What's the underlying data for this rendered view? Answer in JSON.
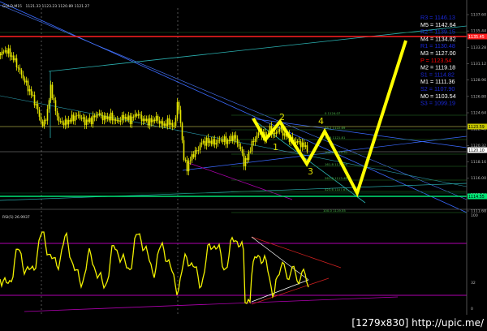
{
  "chart_header": {
    "symbol_info": "GOLD,M15",
    "prices": "1121.33 1123.23 1120.89 1121.27",
    "rsi_label": "RSI(5) 26.9937"
  },
  "colors": {
    "background": "#000000",
    "candles": "#e8e800",
    "rsi_line": "#f2f200",
    "forecast": "#ffff00",
    "red_line": "#ff2020",
    "green_line": "#00e676",
    "teal": "#2ab0b0",
    "blue_line": "#3a6aff",
    "magenta": "#b000b0",
    "level_dark_blue": "#1a28d8",
    "level_red": "#ff0000",
    "level_white": "#ffffff"
  },
  "pivot_levels": [
    {
      "name": "R3",
      "value": "1146.13",
      "style": "dark-blue"
    },
    {
      "name": "M5",
      "value": "1142.64",
      "style": "white"
    },
    {
      "name": "R2",
      "value": "1139.15",
      "style": "dark-blue"
    },
    {
      "name": "M4",
      "value": "1134.82",
      "style": "white"
    },
    {
      "name": "R1",
      "value": "1130.48",
      "style": "dark-blue"
    },
    {
      "name": "M3",
      "value": "1127.00",
      "style": "white"
    },
    {
      "name": "P",
      "value": "1123.54",
      "style": "red"
    },
    {
      "name": "M2",
      "value": "1119.18",
      "style": "white"
    },
    {
      "name": "S1",
      "value": "1114.82",
      "style": "dark-blue"
    },
    {
      "name": "M1",
      "value": "1111.36",
      "style": "white"
    },
    {
      "name": "S2",
      "value": "1107.90",
      "style": "dark-blue"
    },
    {
      "name": "M0",
      "value": "1103.54",
      "style": "white"
    },
    {
      "name": "S3",
      "value": "1099.19",
      "style": "dark-blue"
    }
  ],
  "price_axis_ticks": [
    "1137.60",
    "1135.44",
    "1133.28",
    "1131.12",
    "1128.96",
    "1126.80",
    "1124.64",
    "1122.48",
    "1120.32",
    "1118.16",
    "1116.00",
    "1113.84",
    "1111.68"
  ],
  "axis_boxes": [
    {
      "kind": "red",
      "value": "1135.45"
    },
    {
      "kind": "yellow",
      "value": "1123.59"
    },
    {
      "kind": "white",
      "value": "1120.10"
    },
    {
      "kind": "green",
      "value": "1114.55"
    }
  ],
  "rsi_ticks": [
    "100",
    "32",
    "0"
  ],
  "wave_labels": [
    "1",
    "2",
    "3",
    "4"
  ],
  "fib_labels": [
    "0 1124.07",
    "38.2 1122.69",
    "61.8 1121.81",
    "100.0 1119.70",
    "161.8 1117.09",
    "261.8 1113.48",
    "423.6 1107.67",
    "100.0 1119.55"
  ],
  "watermark": "[1279x830] http://upic.me/",
  "chart_data": {
    "type": "line",
    "series": [],
    "ylim": [
      1110.5,
      1138.5
    ],
    "rsi_ylim": [
      0,
      100
    ],
    "grid": false,
    "legend": "top-right"
  }
}
